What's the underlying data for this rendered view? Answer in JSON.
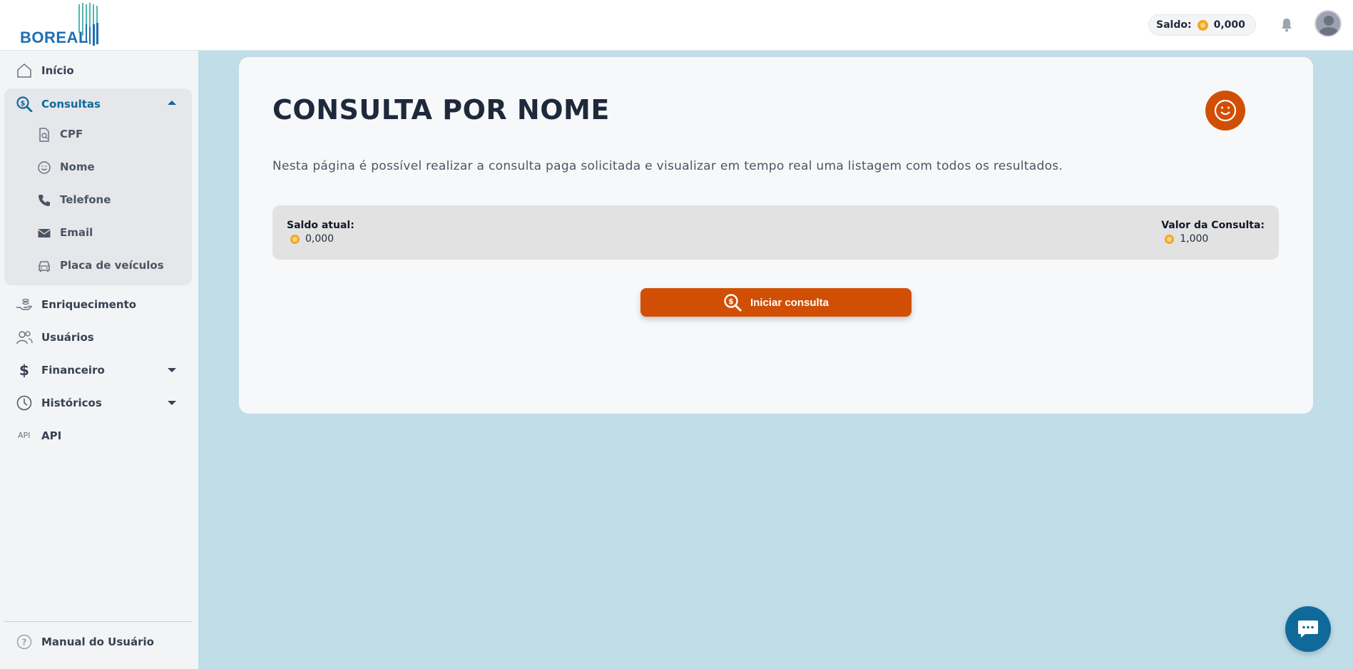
{
  "brand": {
    "logo_text": "BOREAL",
    "primary_color": "#0f6a9b",
    "accent_color": "#d14f05"
  },
  "header": {
    "saldo_label": "Saldo:",
    "saldo_value": "0,000"
  },
  "sidebar": {
    "items": [
      {
        "label": "Início",
        "icon": "home-icon"
      },
      {
        "label": "Consultas",
        "icon": "search-dollar-icon",
        "expanded": true,
        "subitems": [
          {
            "label": "CPF",
            "icon": "document-search-icon"
          },
          {
            "label": "Nome",
            "icon": "smiley-icon"
          },
          {
            "label": "Telefone",
            "icon": "phone-icon"
          },
          {
            "label": "Email",
            "icon": "mail-icon"
          },
          {
            "label": "Placa de veículos",
            "icon": "car-icon"
          }
        ]
      },
      {
        "label": "Enriquecimento",
        "icon": "hand-coins-icon"
      },
      {
        "label": "Usuários",
        "icon": "users-icon"
      },
      {
        "label": "Financeiro",
        "icon": "dollar-icon"
      },
      {
        "label": "Históricos",
        "icon": "clock-icon"
      },
      {
        "label": "API",
        "icon": "api-icon",
        "icon_text": "API"
      }
    ],
    "footer": {
      "label": "Manual do Usuário",
      "icon": "help-circle-icon"
    }
  },
  "main": {
    "title": "CONSULTA POR NOME",
    "description": "Nesta página é possível realizar a consulta paga solicitada e visualizar em tempo real uma listagem com todos os resultados.",
    "saldo_atual_label": "Saldo atual:",
    "saldo_atual_value": "0,000",
    "valor_consulta_label": "Valor da Consulta:",
    "valor_consulta_value": "1,000",
    "start_button_label": "Iniciar consulta"
  }
}
